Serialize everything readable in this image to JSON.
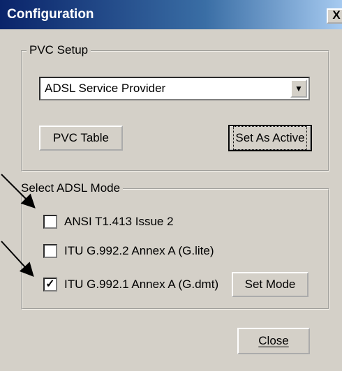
{
  "window": {
    "title": "Configuration",
    "close_glyph": "X"
  },
  "pvc_setup": {
    "group_label": "PVC Setup",
    "provider_selected": "ADSL Service Provider",
    "pvc_table_label": "PVC Table",
    "set_active_label": "Set As Active"
  },
  "adsl_mode": {
    "group_label": "Select ADSL Mode",
    "options": [
      {
        "label": "ANSI T1.413 Issue 2",
        "checked": false,
        "mark": ""
      },
      {
        "label": "ITU G.992.2 Annex A (G.lite)",
        "checked": false,
        "mark": ""
      },
      {
        "label": "ITU G.992.1 Annex A (G.dmt)",
        "checked": true,
        "mark": "✓"
      }
    ],
    "set_mode_label": "Set Mode"
  },
  "footer": {
    "close_label": "Close"
  },
  "colors": {
    "title_bar": "#0a246a",
    "dialog_bg": "#d4d0c8"
  }
}
